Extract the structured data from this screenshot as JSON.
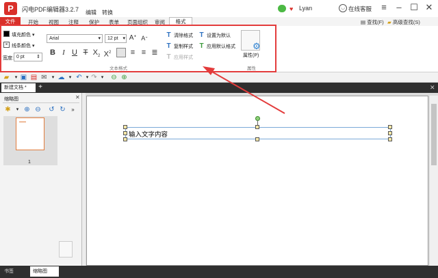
{
  "app": {
    "title": "闪电PDF编辑器3.2.7",
    "logo_letter": "P",
    "tabs_top": [
      "编辑",
      "转换"
    ],
    "user": "Lyan",
    "service": "在线客服"
  },
  "menus": [
    "文件",
    "开始",
    "视图",
    "注释",
    "保护",
    "表单",
    "页面组织",
    "审阅",
    "格式"
  ],
  "menu_right": {
    "find": "查找(F)",
    "advanced_find": "高级查找(S)"
  },
  "ribbon": {
    "fill_color": "填充颜色",
    "line_color": "线条颜色",
    "width_label": "宽度:",
    "width_value": "0 pt",
    "font": "Arial",
    "font_size": "12 pt",
    "group_text_style": "文本格式",
    "clear_format": "清除格式",
    "copy_style": "复制样式",
    "apply_style": "应用样式",
    "set_default": "设置为默认",
    "apply_default": "应用默认格式",
    "properties": "属性(P)",
    "group_properties": "属性"
  },
  "doc": {
    "tab_name": "新建文档 *",
    "text_content": "输入文字内容"
  },
  "sidebar": {
    "title": "缩略图",
    "page_number": "1"
  },
  "bottom_tabs": [
    "书签",
    "缩略图"
  ],
  "colors": {
    "brand": "#d9302a",
    "annotation_red": "#e33b3b",
    "selection": "#7aa9d8"
  }
}
